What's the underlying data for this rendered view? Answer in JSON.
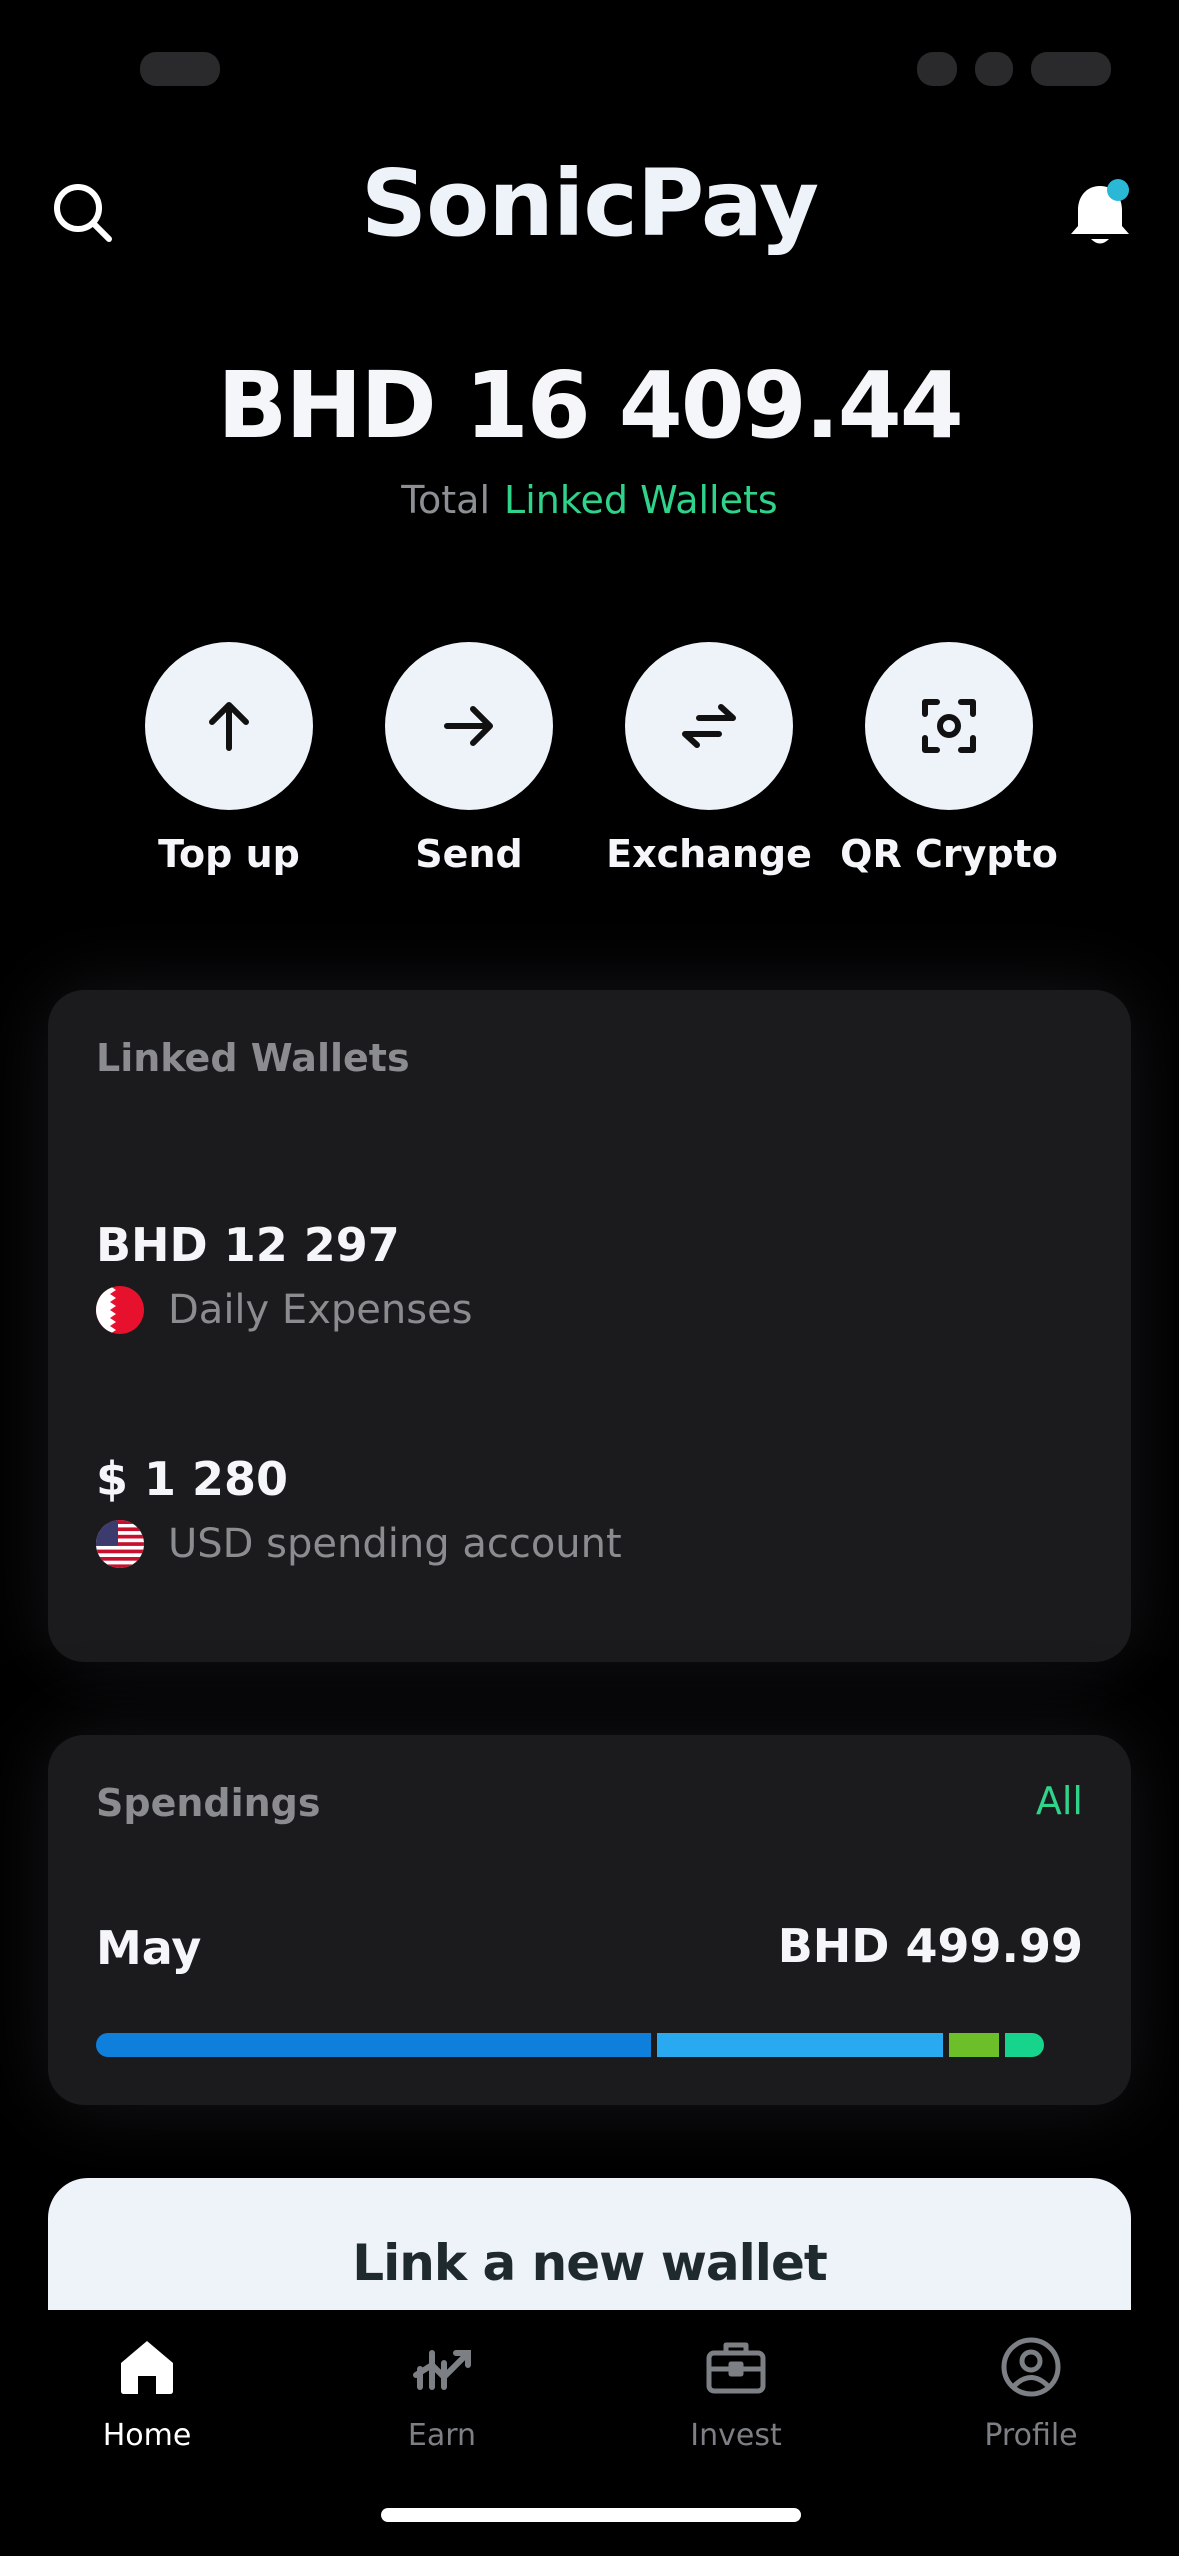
{
  "header": {
    "title": "SonicPay",
    "search_icon": "search-icon",
    "bell_icon": "bell-icon",
    "notification_dot_color": "#2bb8d6"
  },
  "balance": {
    "amount": "BHD 16 409.44",
    "label": "Total",
    "link_label": "Linked Wallets"
  },
  "actions": [
    {
      "label": "Top up",
      "icon": "arrow-up-icon"
    },
    {
      "label": "Send",
      "icon": "arrow-right-icon"
    },
    {
      "label": "Exchange",
      "icon": "exchange-icon"
    },
    {
      "label": "QR Crypto",
      "icon": "qr-scan-icon"
    }
  ],
  "linked_wallets": {
    "title": "Linked Wallets",
    "wallets": [
      {
        "amount": "BHD 12 297",
        "name": "Daily Expenses",
        "flag": "bahrain-flag-icon"
      },
      {
        "amount": "$ 1 280",
        "name": "USD spending account",
        "flag": "us-flag-icon"
      }
    ]
  },
  "spendings": {
    "title": "Spendings",
    "all_label": "All",
    "month": "May",
    "total": "BHD 499.99",
    "breakdown": [
      {
        "fraction": 0.573,
        "color": "#0f7fdc"
      },
      {
        "fraction": 0.295,
        "color": "#29a9f0"
      },
      {
        "fraction": 0.052,
        "color": "#6dbf2a"
      },
      {
        "fraction": 0.04,
        "color": "#17d48c"
      }
    ]
  },
  "link_wallet": {
    "label": "Link a new wallet"
  },
  "tabs": [
    {
      "label": "Home",
      "icon": "home-icon",
      "active": true
    },
    {
      "label": "Earn",
      "icon": "earn-chart-icon",
      "active": false
    },
    {
      "label": "Invest",
      "icon": "briefcase-icon",
      "active": false
    },
    {
      "label": "Profile",
      "icon": "profile-icon",
      "active": false
    }
  ],
  "colors": {
    "accent_green": "#2fd38a",
    "card_bg": "#1b1b1d",
    "button_bg": "#eef3f9"
  }
}
